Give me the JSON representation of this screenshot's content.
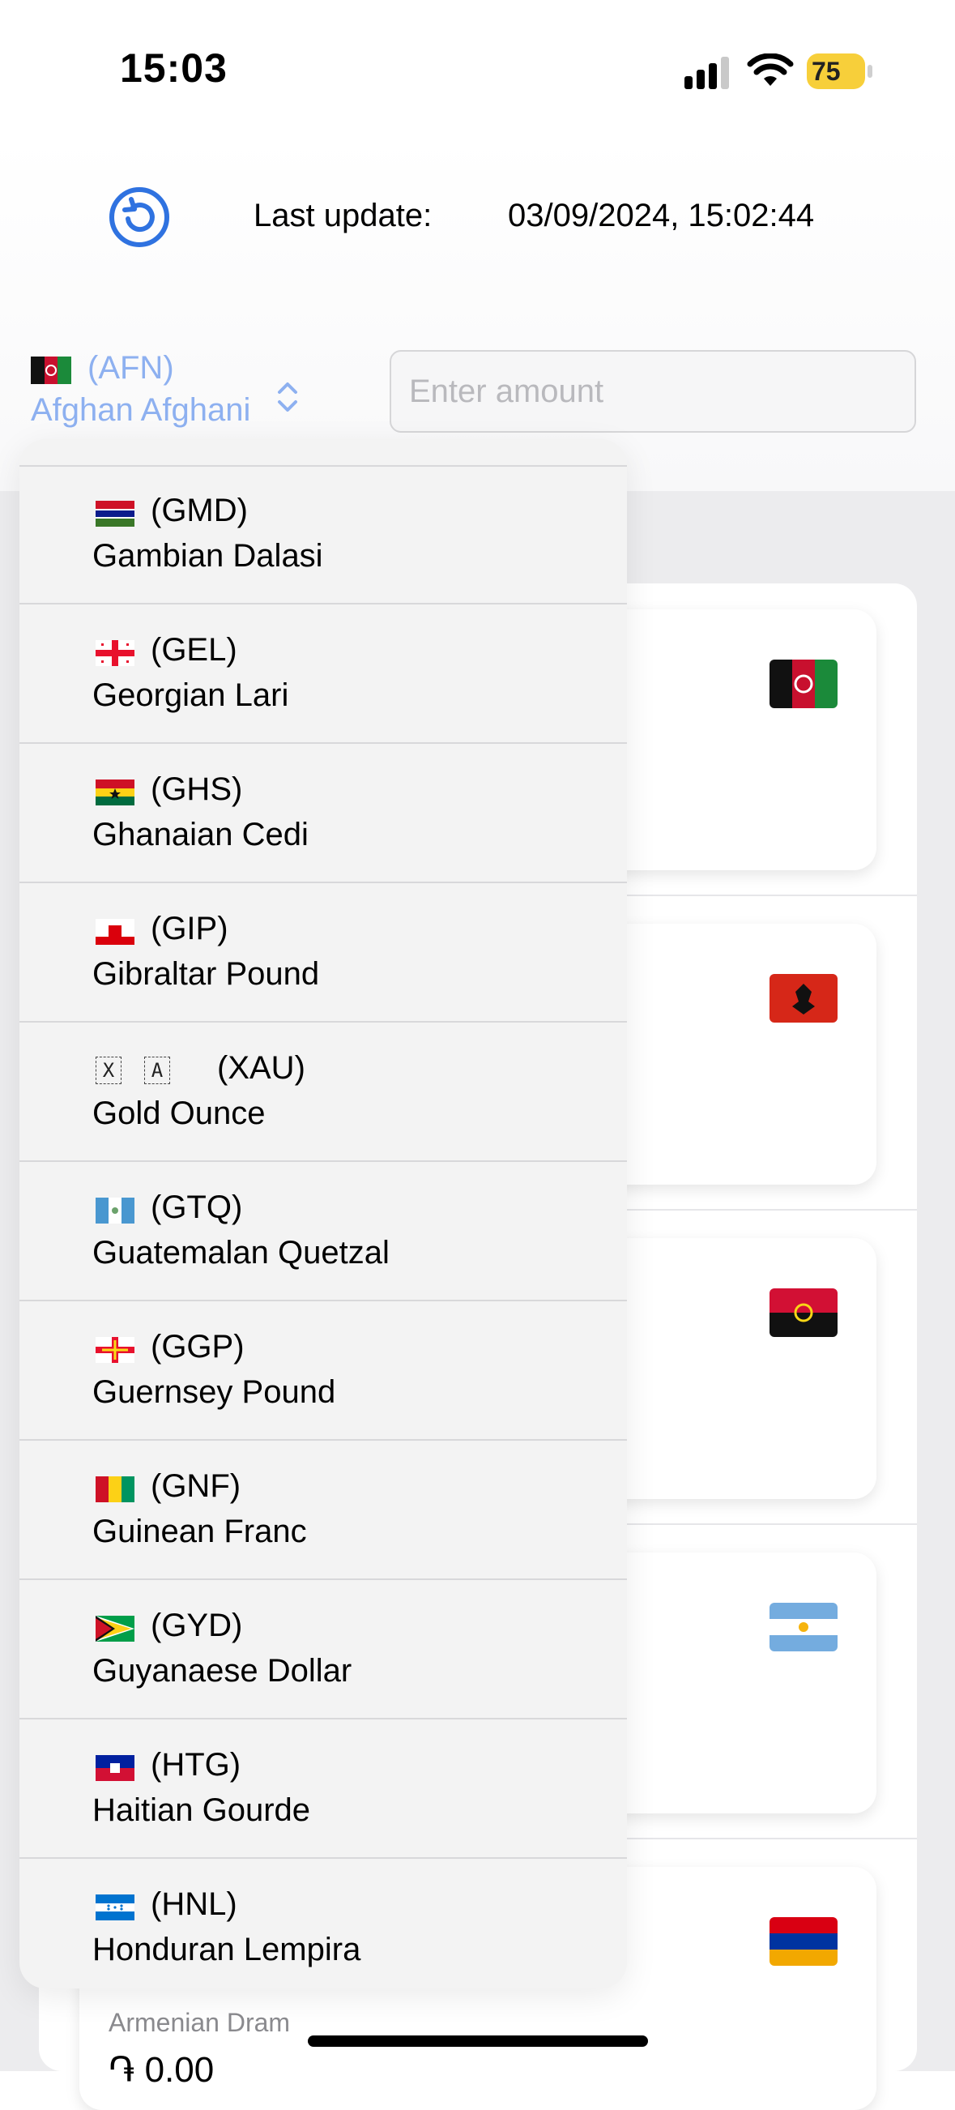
{
  "status_bar": {
    "time": "15:03",
    "battery_level": "75"
  },
  "header": {
    "last_update_label": "Last update:",
    "last_update_value": "03/09/2024, 15:02:44"
  },
  "selector": {
    "code": "(AFN)",
    "name": "Afghan Afghani",
    "amount_placeholder": "Enter amount",
    "amount_value": ""
  },
  "dropdown_items": [
    {
      "code": "(GMD)",
      "name": "Gambian Dalasi",
      "flag": "gambia-flag-icon"
    },
    {
      "code": "(GEL)",
      "name": "Georgian Lari",
      "flag": "georgia-flag-icon"
    },
    {
      "code": "(GHS)",
      "name": "Ghanaian Cedi",
      "flag": "ghana-flag-icon"
    },
    {
      "code": "(GIP)",
      "name": "Gibraltar Pound",
      "flag": "gibraltar-flag-icon"
    },
    {
      "code": "(XAU)",
      "name": "Gold Ounce",
      "flag": "missing-glyph-icon",
      "glyph_letters": [
        "X",
        "A"
      ]
    },
    {
      "code": "(GTQ)",
      "name": "Guatemalan Quetzal",
      "flag": "guatemala-flag-icon"
    },
    {
      "code": "(GGP)",
      "name": "Guernsey Pound",
      "flag": "guernsey-flag-icon"
    },
    {
      "code": "(GNF)",
      "name": "Guinean Franc",
      "flag": "guinea-flag-icon"
    },
    {
      "code": "(GYD)",
      "name": "Guyanaese Dollar",
      "flag": "guyana-flag-icon"
    },
    {
      "code": "(HTG)",
      "name": "Haitian Gourde",
      "flag": "haiti-flag-icon"
    },
    {
      "code": "(HNL)",
      "name": "Honduran Lempira",
      "flag": "honduras-flag-icon"
    }
  ],
  "result_cards": [
    {
      "flag": "afghanistan-flag-icon",
      "name": "",
      "value": ""
    },
    {
      "flag": "albania-flag-icon",
      "name": "",
      "value": ""
    },
    {
      "flag": "angola-flag-icon",
      "name": "",
      "value": ""
    },
    {
      "flag": "argentina-flag-icon",
      "name": "",
      "value": ""
    },
    {
      "flag": "armenia-flag-icon",
      "name": "Armenian Dram",
      "value": "֏ 0.00"
    }
  ],
  "colors": {
    "accent": "#2f72e0",
    "selector_text": "#8db0f0",
    "battery": "#f7cf3a",
    "background": "#ececee"
  }
}
